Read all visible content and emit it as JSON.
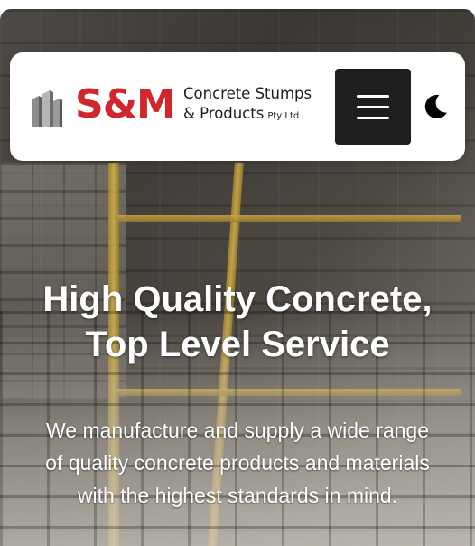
{
  "header": {
    "logo": {
      "brand": "S&M",
      "line1": "Concrete Stumps",
      "line2": "& Products",
      "suffix": "Pty Ltd",
      "icon": "building-blocks-icon"
    },
    "menu_button_icon": "hamburger-menu-icon",
    "theme_toggle_icon": "moon-icon"
  },
  "hero": {
    "title_line1": "High Quality Concrete,",
    "title_line2": "Top Level Service",
    "subtitle": "We manufacture and supply a wide range of quality concrete products and materials with the highest standards in mind."
  },
  "colors": {
    "brand_red": "#d1262b",
    "menu_button_bg": "#1e1e1e",
    "header_bg": "#ffffff",
    "hero_text": "#ffffff"
  }
}
